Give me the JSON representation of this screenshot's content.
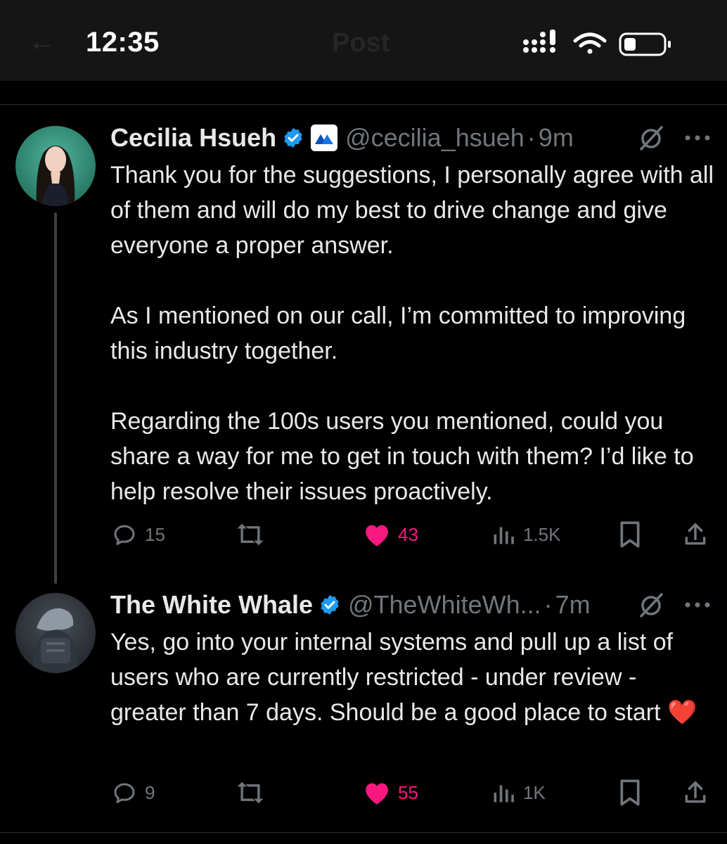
{
  "status_bar": {
    "time": "12:35"
  },
  "header": {
    "back_icon": "back-arrow-icon",
    "title": "Post"
  },
  "tweets": [
    {
      "name": "Cecilia Hsueh",
      "handle": "@cecilia_hsueh",
      "separator": "·",
      "age": "9m",
      "verified": true,
      "affiliate_icon": "mexc-logo-icon",
      "paragraphs": [
        "Thank you for the suggestions, I personally agree with all of them and will do my best to drive change and give everyone a proper answer.",
        "As I mentioned on our call, I’m committed to improving this industry together.",
        "Regarding the 100s users you mentioned, could you share a way for me to get in touch with them? I’d like to help resolve their issues proactively."
      ],
      "stats": {
        "replies": "15",
        "reposts": "",
        "likes": "43",
        "views": "1.5K"
      }
    },
    {
      "name": "The White Whale",
      "handle": "@TheWhiteWh...",
      "separator": "·",
      "age": "7m",
      "verified": true,
      "text": "Yes, go into your internal systems and pull up a list of users who are currently restricted - under review - greater than 7 days. Should be a good place to start",
      "emoji": "❤️",
      "stats": {
        "replies": "9",
        "reposts": "",
        "likes": "55",
        "views": "1K"
      }
    }
  ],
  "colors": {
    "background": "#000000",
    "text": "#e7e9ea",
    "muted": "#71767b",
    "verified": "#1d9bf0",
    "like": "#f91880"
  }
}
